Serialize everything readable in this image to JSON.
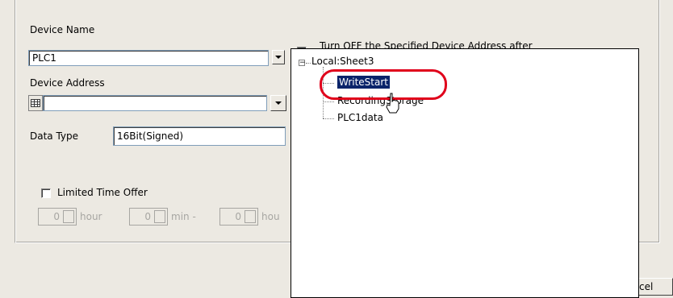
{
  "form": {
    "device_name_label": "Device Name",
    "device_name_value": "PLC1",
    "device_address_label": "Device Address",
    "device_address_value": "",
    "data_type_label": "Data Type",
    "data_type_value": "16Bit(Signed)",
    "turn_off_label": "Turn OFF the Specified Device Address after",
    "limited_time_label": "Limited Time Offer",
    "spin_hour_value": "0",
    "spin_hour_unit": "hour",
    "spin_min_value": "0",
    "spin_min_unit": "min -",
    "spin_hour2_value": "0",
    "spin_hour2_unit": "hou"
  },
  "popup": {
    "root_label": "Local:Sheet3",
    "items": [
      {
        "label": "WriteStart",
        "selected": true
      },
      {
        "label": "RecordingStorage",
        "selected": false
      },
      {
        "label": "PLC1data",
        "selected": false
      }
    ]
  },
  "footer": {
    "cancel_fragment": "cel"
  },
  "colors": {
    "highlight_ring": "#e0001b",
    "selection": "#0a246a",
    "dialog_bg": "#ece9e2"
  }
}
